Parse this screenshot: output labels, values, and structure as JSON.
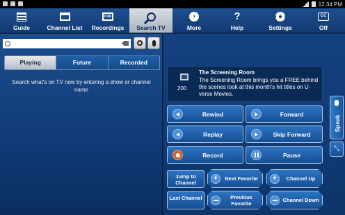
{
  "status_bar": {
    "time": "12:34 PM"
  },
  "nav": {
    "items": [
      {
        "label": "Guide",
        "icon": "guide-icon"
      },
      {
        "label": "Channel List",
        "icon": "channel-list-icon"
      },
      {
        "label": "Recordings",
        "icon": "dvr-icon",
        "badge": "DVR"
      },
      {
        "label": "Search TV",
        "icon": "search-icon",
        "active": true
      },
      {
        "label": "More",
        "icon": "more-icon"
      },
      {
        "label": "Help",
        "icon": "help-icon"
      },
      {
        "label": "Settings",
        "icon": "gear-icon"
      },
      {
        "label": "Off",
        "icon": "cc-icon",
        "badge": "CC"
      }
    ]
  },
  "search": {
    "placeholder": "",
    "value": ""
  },
  "tabs": [
    {
      "label": "Playing",
      "active": true
    },
    {
      "label": "Future",
      "active": false
    },
    {
      "label": "Recorded",
      "active": false
    }
  ],
  "hint": "Search what's on TV now by entering a show or channel name",
  "program": {
    "channel": "200",
    "title": "The Screening Room",
    "description": "The Screening Room brings you a FREE behind the scenes look at this month's hit titles on U-verse Movies."
  },
  "remote": {
    "rewind": "Rewind",
    "forward": "Forward",
    "replay": "Replay",
    "skip_forward": "Skip Forward",
    "record": "Record",
    "pause": "Pause",
    "jump_to_channel": "Jump to Channel",
    "next_favorite": "Next Favorite",
    "channel_up": "Channel Up",
    "last_channel": "Last Channel",
    "previous_favorite": "Previous Favorite",
    "channel_down": "Channel Down",
    "speak": "Speak"
  },
  "colors": {
    "accent_blue": "#2c73c2",
    "record_orange": "#d3632d",
    "background": "#0b2a55"
  }
}
